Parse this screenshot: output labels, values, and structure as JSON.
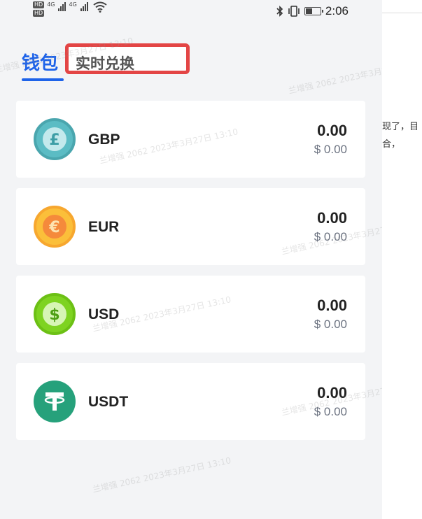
{
  "status_bar": {
    "hd1": "HD",
    "hd2": "HD",
    "net1": "4G",
    "net2": "4G",
    "time": "2:06",
    "icons": [
      "bluetooth-icon",
      "vibrate-icon",
      "battery-icon",
      "wifi-icon"
    ],
    "battery_level": 0.45
  },
  "tabs": {
    "wallet_label": "钱包",
    "exchange_label": "实时兑换",
    "active": "wallet",
    "accent_color": "#1e63e9",
    "highlight_color": "#e34545"
  },
  "wallet": [
    {
      "symbol": "£",
      "name": "GBP",
      "amount": "0.00",
      "usd_value": "$ 0.00",
      "icon": "pound-coin-icon",
      "color": "#5bbcc4"
    },
    {
      "symbol": "€",
      "name": "EUR",
      "amount": "0.00",
      "usd_value": "$ 0.00",
      "icon": "euro-coin-icon",
      "color": "#f7a72f"
    },
    {
      "symbol": "$",
      "name": "USD",
      "amount": "0.00",
      "usd_value": "$ 0.00",
      "icon": "dollar-coin-icon",
      "color": "#7ed321"
    },
    {
      "symbol": "T",
      "name": "USDT",
      "amount": "0.00",
      "usd_value": "$ 0.00",
      "icon": "tether-icon",
      "color": "#26a17b"
    }
  ],
  "watermark": "兰增强 2062 2023年3月27日 13:10",
  "side_text": {
    "line1": "现了，目",
    "line2": "合，"
  }
}
